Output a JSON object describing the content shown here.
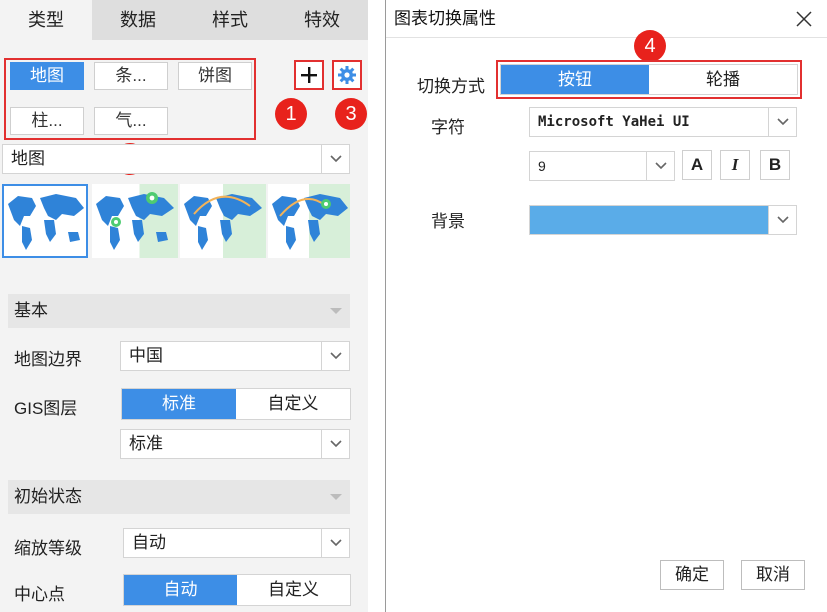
{
  "left_panel": {
    "tabs": [
      "类型",
      "数据",
      "样式",
      "特效"
    ],
    "chart_types": [
      "地图",
      "条...",
      "饼图",
      "柱...",
      "气..."
    ],
    "add_label": "+",
    "badges": [
      "1",
      "2",
      "3"
    ],
    "chart_type_select": "地图",
    "sections": {
      "basic": "基本",
      "initial_state": "初始状态"
    },
    "map_border": {
      "label": "地图边界",
      "value": "中国"
    },
    "gis_layer": {
      "label": "GIS图层",
      "options": [
        "标准",
        "自定义"
      ],
      "selected": "标准",
      "select_value": "标准"
    },
    "zoom_level": {
      "label": "缩放等级",
      "value": "自动"
    },
    "center_point": {
      "label": "中心点",
      "options": [
        "自动",
        "自定义"
      ],
      "selected": "自动"
    }
  },
  "dialog": {
    "title": "图表切换属性",
    "badge": "4",
    "switch_mode": {
      "label": "切换方式",
      "options": [
        "按钮",
        "轮播"
      ],
      "selected": "按钮"
    },
    "font": {
      "label": "字符",
      "family": "Microsoft YaHei UI",
      "size": "9",
      "bold": "A",
      "italic": "I",
      "underline": "B"
    },
    "background": {
      "label": "背景",
      "color": "#5aace8"
    },
    "ok_label": "确定",
    "cancel_label": "取消"
  },
  "colors": {
    "accent": "#3d8ee6",
    "highlight": "#e23030",
    "map_land": "#2f83d8",
    "map_bg": "#d7efd9"
  }
}
